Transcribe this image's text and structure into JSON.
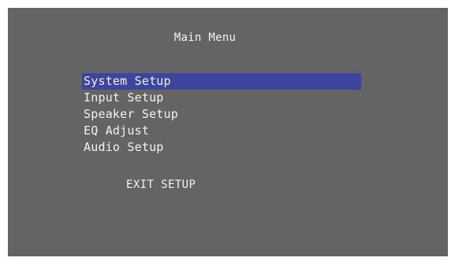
{
  "menu": {
    "title": "Main Menu",
    "items": [
      {
        "label": "System Setup",
        "selected": true
      },
      {
        "label": "Input Setup",
        "selected": false
      },
      {
        "label": "Speaker Setup",
        "selected": false
      },
      {
        "label": "EQ Adjust",
        "selected": false
      },
      {
        "label": "Audio Setup",
        "selected": false
      }
    ],
    "exit_label": "EXIT SETUP"
  },
  "colors": {
    "background": "#646464",
    "highlight": "#3c46a0",
    "text": "#f2f2f2"
  }
}
